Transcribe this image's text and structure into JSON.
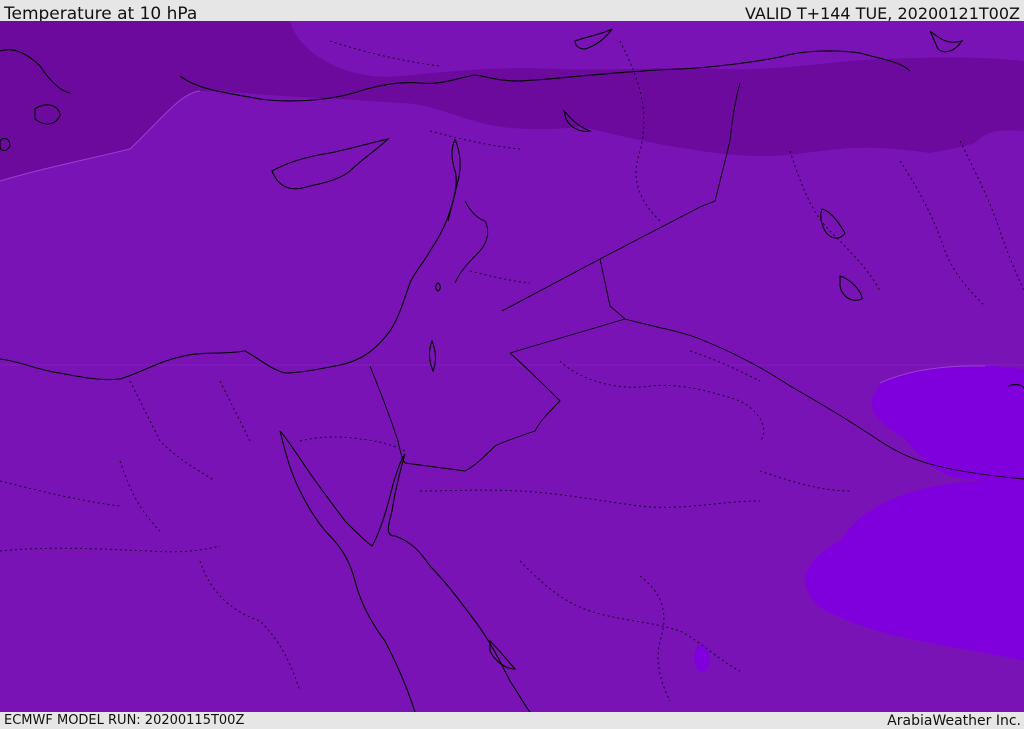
{
  "header": {
    "title": "Temperature at 10 hPa",
    "valid": "VALID T+144 TUE, 20200121T00Z"
  },
  "footer": {
    "model_run": "ECMWF MODEL RUN: 20200115T00Z",
    "brand": "ArabiaWeather Inc."
  },
  "map": {
    "field": "temperature",
    "level": "10 hPa",
    "legend_visible": false,
    "colors": {
      "base_fill": "#7a13b6",
      "colder_band": "#6c0a9e",
      "warmer_patch": "#8000dd",
      "contour_line": "#9b3fd1",
      "coastline": "#000000",
      "border_dotted": "#1a0030"
    }
  }
}
